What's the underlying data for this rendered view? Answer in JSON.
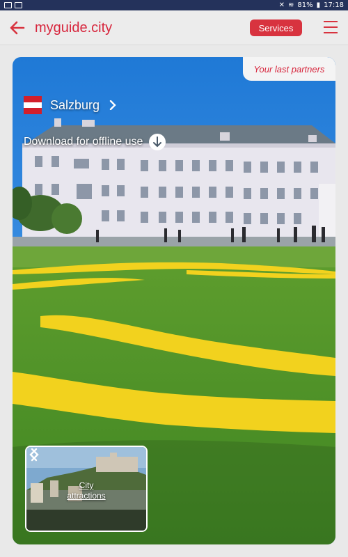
{
  "status": {
    "battery": "81%",
    "time": "17:18"
  },
  "header": {
    "brand": "myguide.city",
    "services_label": "Services"
  },
  "hero": {
    "partners_label": "Your last partners",
    "city": "Salzburg",
    "offline_label": "Download for offline use"
  },
  "thumb": {
    "line1": "City",
    "line2": "attractions"
  },
  "colors": {
    "accent": "#d8333f",
    "brand_text": "#d7263d",
    "status_bar": "#24325b",
    "austria_red": "#d21f2b"
  }
}
